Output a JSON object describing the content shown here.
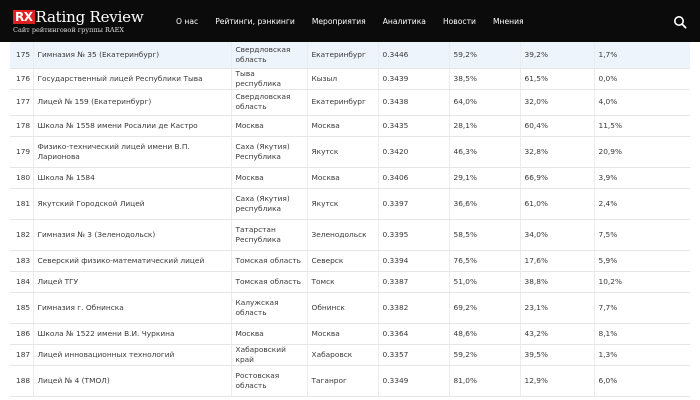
{
  "header": {
    "logo_badge": "RX",
    "logo_text": "Rating Review",
    "logo_sub": "Сайт рейтинговой группы RAEX",
    "nav": [
      "О нас",
      "Рейтинги, рэнкинги",
      "Мероприятия",
      "Аналитика",
      "Новости",
      "Мнения"
    ]
  },
  "rows": [
    {
      "n": "175",
      "name": "Гимназия № 35 (Екатеринбург)",
      "region": "Свердловская область",
      "city": "Екатеринбург",
      "score": "0.3446",
      "a": "59,2%",
      "b": "39,2%",
      "c": "1,7%"
    },
    {
      "n": "176",
      "name": "Государственный лицей Республики Тыва",
      "region": "Тыва республика",
      "city": "Кызыл",
      "score": "0.3439",
      "a": "38,5%",
      "b": "61,5%",
      "c": "0,0%"
    },
    {
      "n": "177",
      "name": "Лицей № 159 (Екатеринбург)",
      "region": "Свердловская область",
      "city": "Екатеринбург",
      "score": "0.3438",
      "a": "64,0%",
      "b": "32,0%",
      "c": "4,0%"
    },
    {
      "n": "178",
      "name": "Школа № 1558 имени Росалии де Кастро",
      "region": "Москва",
      "city": "Москва",
      "score": "0.3435",
      "a": "28,1%",
      "b": "60,4%",
      "c": "11,5%"
    },
    {
      "n": "179",
      "name": "Физико-технический лицей имени В.П. Ларионова",
      "region": "Саха (Якутия) Республика",
      "city": "Якутск",
      "score": "0.3420",
      "a": "46,3%",
      "b": "32,8%",
      "c": "20,9%"
    },
    {
      "n": "180",
      "name": "Школа № 1584",
      "region": "Москва",
      "city": "Москва",
      "score": "0.3406",
      "a": "29,1%",
      "b": "66,9%",
      "c": "3,9%"
    },
    {
      "n": "181",
      "name": "Якутский Городской Лицей",
      "region": "Саха (Якутия) республика",
      "city": "Якутск",
      "score": "0.3397",
      "a": "36,6%",
      "b": "61,0%",
      "c": "2,4%"
    },
    {
      "n": "182",
      "name": "Гимназия № 3 (Зеленодольск)",
      "region": "Татарстан Республика",
      "city": "Зеленодольск",
      "score": "0.3395",
      "a": "58,5%",
      "b": "34,0%",
      "c": "7,5%"
    },
    {
      "n": "183",
      "name": "Северский физико-математический лицей",
      "region": "Томская область",
      "city": "Северск",
      "score": "0.3394",
      "a": "76,5%",
      "b": "17,6%",
      "c": "5,9%"
    },
    {
      "n": "184",
      "name": "Лицей ТГУ",
      "region": "Томская область",
      "city": "Томск",
      "score": "0.3387",
      "a": "51,0%",
      "b": "38,8%",
      "c": "10,2%"
    },
    {
      "n": "185",
      "name": "Гимназия г. Обнинска",
      "region": "Калужская область",
      "city": "Обнинск",
      "score": "0.3382",
      "a": "69,2%",
      "b": "23,1%",
      "c": "7,7%"
    },
    {
      "n": "186",
      "name": "Школа № 1522 имени В.И. Чуркина",
      "region": "Москва",
      "city": "Москва",
      "score": "0.3364",
      "a": "48,6%",
      "b": "43,2%",
      "c": "8,1%"
    },
    {
      "n": "187",
      "name": "Лицей инновационных технологий",
      "region": "Хабаровский край",
      "city": "Хабаровск",
      "score": "0.3357",
      "a": "59,2%",
      "b": "39,5%",
      "c": "1,3%"
    },
    {
      "n": "188",
      "name": "Лицей № 4 (ТМОЛ)",
      "region": "Ростовская область",
      "city": "Таганрог",
      "score": "0.3349",
      "a": "81,0%",
      "b": "12,9%",
      "c": "6,0%"
    }
  ]
}
